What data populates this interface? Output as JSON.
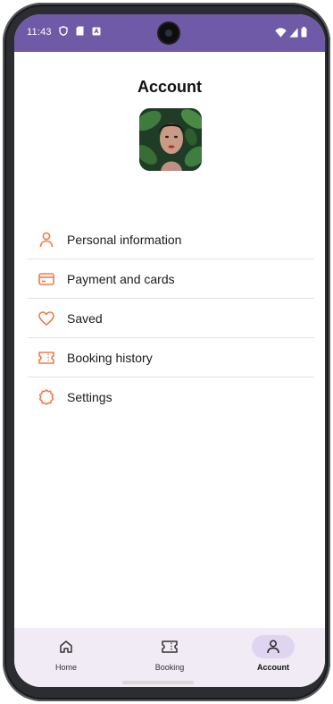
{
  "status_bar": {
    "time": "11:43"
  },
  "header": {
    "title": "Account"
  },
  "menu": {
    "items": [
      {
        "label": "Personal information",
        "icon": "person-icon"
      },
      {
        "label": "Payment and cards",
        "icon": "credit-card-icon"
      },
      {
        "label": "Saved",
        "icon": "heart-icon"
      },
      {
        "label": "Booking history",
        "icon": "ticket-icon"
      },
      {
        "label": "Settings",
        "icon": "gear-icon"
      }
    ]
  },
  "bottom_nav": {
    "items": [
      {
        "label": "Home",
        "icon": "home-icon",
        "active": false
      },
      {
        "label": "Booking",
        "icon": "ticket-icon",
        "active": false
      },
      {
        "label": "Account",
        "icon": "person-icon",
        "active": true
      }
    ]
  },
  "colors": {
    "status_bar": "#6f5aa8",
    "accent_icon": "#f07a4b",
    "nav_background": "#f1ebf5",
    "nav_active_pill": "#e0d5f0"
  }
}
